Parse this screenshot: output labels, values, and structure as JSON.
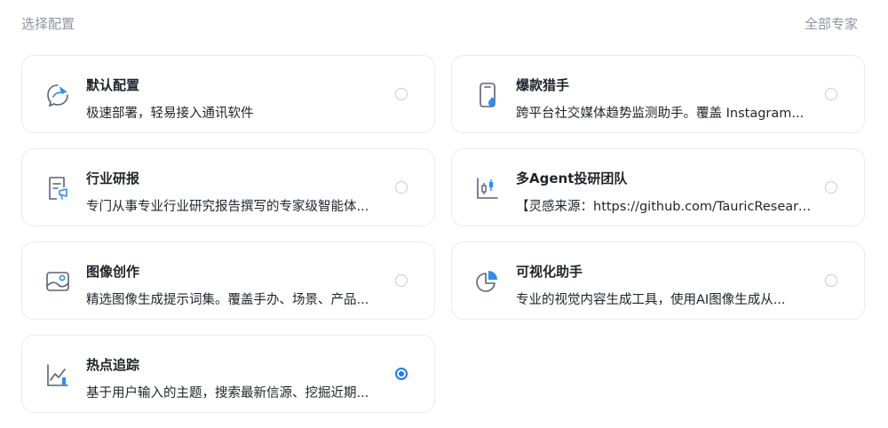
{
  "header": {
    "title": "选择配置",
    "all_experts_link": "全部专家"
  },
  "configs": [
    {
      "title": "默认配置",
      "description": "极速部署，轻易接入通讯软件",
      "icon": "chat-bubble-icon",
      "selected": false
    },
    {
      "title": "爆款猎手",
      "description": "跨平台社交媒体趋势监测助手。覆盖 Instagram...",
      "icon": "phone-flame-icon",
      "selected": false
    },
    {
      "title": "行业研报",
      "description": "专门从事专业行业研究报告撰写的专家级智能体...",
      "icon": "report-document-icon",
      "selected": false
    },
    {
      "title": "多Agent投研团队",
      "description": "【灵感来源：https://github.com/TauricResearch...",
      "icon": "candlestick-chart-icon",
      "selected": false
    },
    {
      "title": "图像创作",
      "description": "精选图像生成提示词集。覆盖手办、场景、产品...",
      "icon": "image-icon",
      "selected": false
    },
    {
      "title": "可视化助手",
      "description": "专业的视觉内容生成工具，使用AI图像生成从...",
      "icon": "pie-chart-icon",
      "selected": false
    },
    {
      "title": "热点追踪",
      "description": "基于用户输入的主题，搜索最新信源、挖掘近期...",
      "icon": "trend-chart-icon",
      "selected": true
    }
  ],
  "colors": {
    "accent": "#1a7cf4",
    "icon_stroke": "#5a6270",
    "icon_accent": "#2f8cf0"
  }
}
